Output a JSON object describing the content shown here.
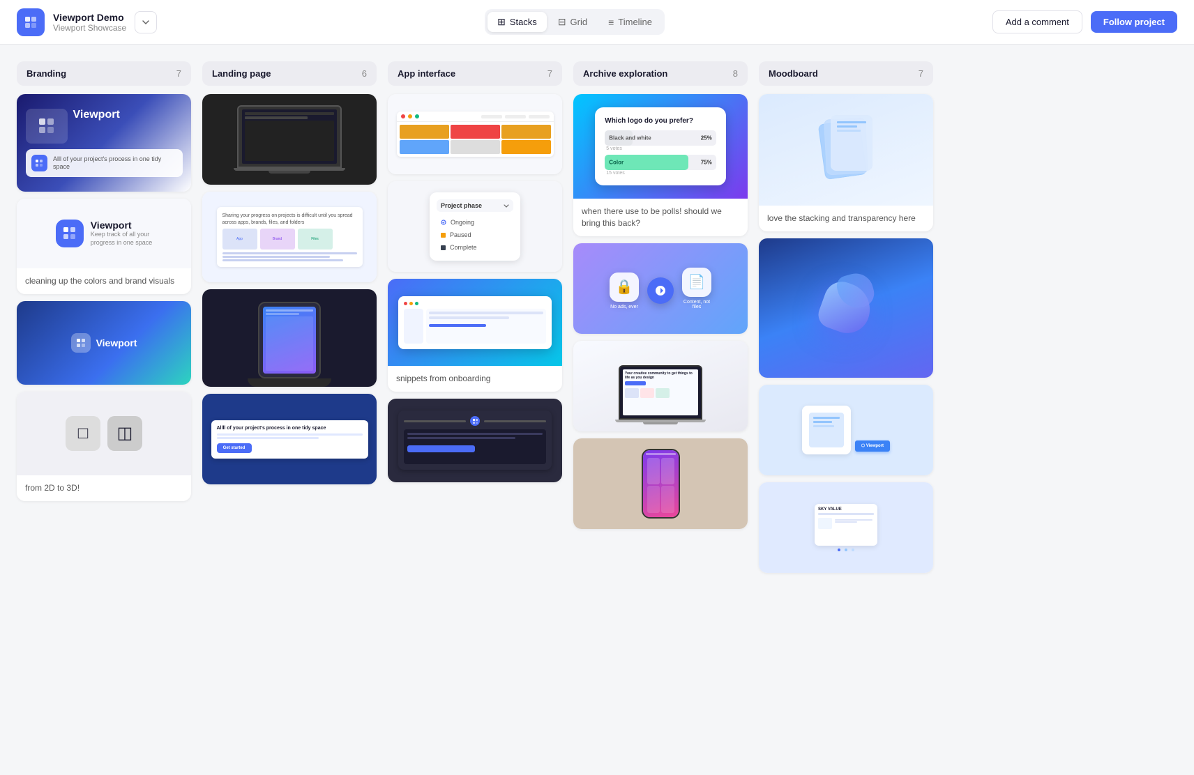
{
  "app": {
    "logo_icon": "□",
    "project_name": "Viewport Demo",
    "project_sub": "Viewport Showcase",
    "dropdown_icon": "∨"
  },
  "nav": {
    "views": [
      {
        "id": "stacks",
        "label": "Stacks",
        "icon": "⊞",
        "active": true
      },
      {
        "id": "grid",
        "label": "Grid",
        "icon": "⊟",
        "active": false
      },
      {
        "id": "timeline",
        "label": "Timeline",
        "icon": "≡",
        "active": false
      }
    ]
  },
  "header_actions": {
    "add_comment": "Add a comment",
    "follow_project": "Follow project"
  },
  "columns": [
    {
      "id": "branding",
      "title": "Branding",
      "count": 7,
      "items": [
        {
          "id": "brand-1",
          "type": "image",
          "label": ""
        },
        {
          "id": "brand-2",
          "type": "image",
          "label": "cleaning up the colors and brand visuals"
        },
        {
          "id": "brand-3",
          "type": "image",
          "label": ""
        },
        {
          "id": "brand-4",
          "type": "image",
          "label": "from 2D to 3D!"
        }
      ]
    },
    {
      "id": "landing",
      "title": "Landing page",
      "count": 6,
      "items": [
        {
          "id": "land-1",
          "type": "image",
          "label": ""
        },
        {
          "id": "land-2",
          "type": "image",
          "label": ""
        },
        {
          "id": "land-3",
          "type": "image",
          "label": ""
        },
        {
          "id": "land-4",
          "type": "image",
          "label": ""
        }
      ]
    },
    {
      "id": "app-interface",
      "title": "App interface",
      "count": 7,
      "items": [
        {
          "id": "app-1",
          "type": "image",
          "label": ""
        },
        {
          "id": "app-2",
          "type": "image",
          "label": ""
        },
        {
          "id": "app-3",
          "type": "image",
          "label": "snippets from onboarding"
        },
        {
          "id": "app-4",
          "type": "image",
          "label": ""
        }
      ]
    },
    {
      "id": "archive",
      "title": "Archive exploration",
      "count": 8,
      "items": [
        {
          "id": "arch-1",
          "type": "poll",
          "label": "when there use to be polls! should we bring this back?"
        },
        {
          "id": "arch-2",
          "type": "image",
          "label": ""
        },
        {
          "id": "arch-3",
          "type": "image",
          "label": ""
        },
        {
          "id": "arch-4",
          "type": "image",
          "label": ""
        }
      ]
    },
    {
      "id": "moodboard",
      "title": "Moodboard",
      "count": 7,
      "items": [
        {
          "id": "mood-1",
          "type": "image",
          "label": "love the stacking and transparency here"
        },
        {
          "id": "mood-2",
          "type": "image",
          "label": ""
        },
        {
          "id": "mood-3",
          "type": "image",
          "label": ""
        },
        {
          "id": "mood-4",
          "type": "image",
          "label": ""
        }
      ]
    }
  ],
  "poll": {
    "question": "Which logo do you prefer?",
    "options": [
      {
        "label": "Black and white",
        "sub": "5 votes",
        "pct": 25,
        "color": "#e5e7eb"
      },
      {
        "label": "Color",
        "sub": "15 votes",
        "pct": 75,
        "color": "#6ee7b7"
      }
    ]
  },
  "labels": {
    "brand_label_2": "cleaning up the colors and brand visuals",
    "brand_label_4": "from 2D to 3D!",
    "app_label_3": "snippets from onboarding",
    "arch_label_1": "when there use to be polls! should we bring this back?",
    "mood_label_1": "love the stacking and transparency here"
  }
}
